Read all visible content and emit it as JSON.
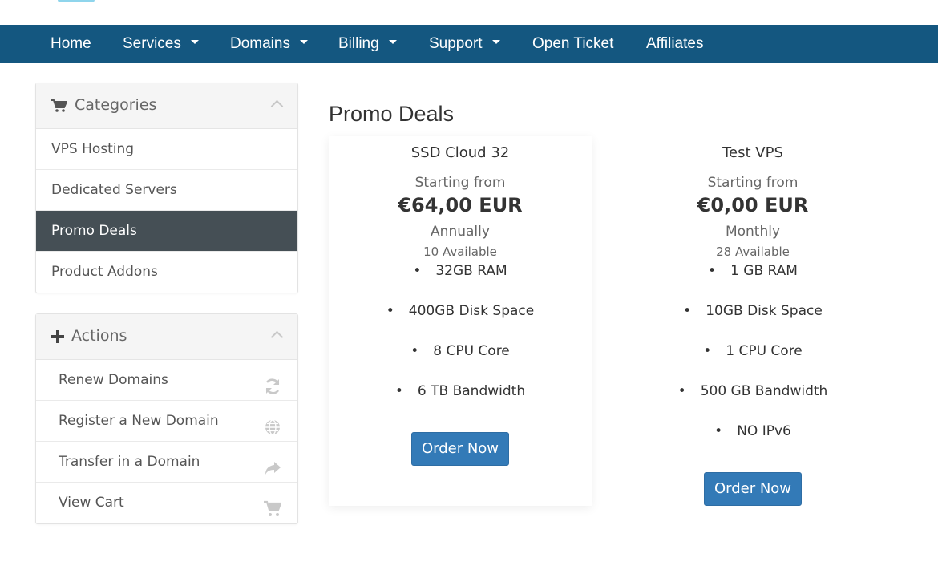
{
  "nav": {
    "items": [
      {
        "label": "Home",
        "dropdown": false
      },
      {
        "label": "Services",
        "dropdown": true
      },
      {
        "label": "Domains",
        "dropdown": true
      },
      {
        "label": "Billing",
        "dropdown": true
      },
      {
        "label": "Support",
        "dropdown": true
      },
      {
        "label": "Open Ticket",
        "dropdown": false
      },
      {
        "label": "Affiliates",
        "dropdown": false
      }
    ]
  },
  "sidebar": {
    "categories": {
      "title": "Categories",
      "icon": "shopping-cart-icon",
      "items": [
        {
          "label": "VPS Hosting",
          "active": false
        },
        {
          "label": "Dedicated Servers",
          "active": false
        },
        {
          "label": "Promo Deals",
          "active": true
        },
        {
          "label": "Product Addons",
          "active": false
        }
      ]
    },
    "actions": {
      "title": "Actions",
      "icon": "plus-icon",
      "items": [
        {
          "label": "Renew Domains",
          "icon": "refresh-icon"
        },
        {
          "label": "Register a New Domain",
          "icon": "globe-icon"
        },
        {
          "label": "Transfer in a Domain",
          "icon": "share-arrow-icon"
        },
        {
          "label": "View Cart",
          "icon": "shopping-cart-icon"
        }
      ]
    }
  },
  "main": {
    "title": "Promo Deals",
    "products": [
      {
        "name": "SSD Cloud 32",
        "starting_from": "Starting from",
        "price": "€64,00 EUR",
        "cycle": "Annually",
        "available": "10 Available",
        "features": [
          "32GB RAM",
          "400GB Disk Space",
          "8 CPU Core",
          "6 TB Bandwidth"
        ],
        "order_label": "Order Now"
      },
      {
        "name": "Test VPS",
        "starting_from": "Starting from",
        "price": "€0,00 EUR",
        "cycle": "Monthly",
        "available": "28 Available",
        "features": [
          "1 GB RAM",
          "10GB Disk Space",
          "1 CPU Core",
          "500 GB Bandwidth",
          "NO IPv6"
        ],
        "order_label": "Order Now"
      }
    ]
  },
  "colors": {
    "navbar": "#145780",
    "active_item": "#454f55",
    "button": "#337ab7"
  }
}
